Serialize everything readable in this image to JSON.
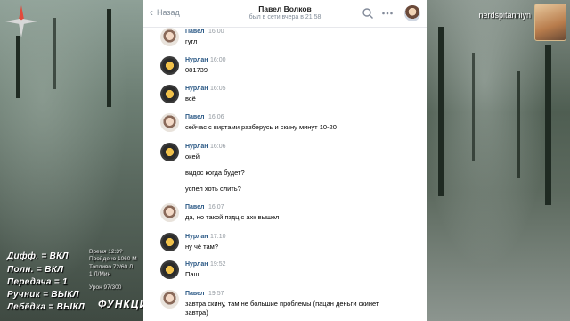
{
  "hud": {
    "lines": [
      "Дифф. = ВКЛ",
      "Полн. = ВКЛ",
      "Передача = 1",
      "Ручник = ВЫКЛ",
      "Лебёдка = ВЫКЛ"
    ],
    "small": [
      "Время 12:3?",
      "Пройдено 1060 М",
      "Топливо 72/60 Л",
      "1 Л/Мин",
      "Урон 97/300"
    ],
    "functions": "ФУНКЦИ",
    "streamer": "nerdspitanniyn"
  },
  "header": {
    "back_label": "Назад",
    "title": "Павел Волков",
    "status": "был в сети вчера в 21:58",
    "icons": [
      "search-icon",
      "more-icon"
    ]
  },
  "messages": [
    {
      "author": "Павел",
      "time": "16:00",
      "avatar": "pavel",
      "lines": [
        "гугл"
      ]
    },
    {
      "author": "Нурлан",
      "time": "16:00",
      "avatar": "nurlan",
      "lines": [
        "081739"
      ]
    },
    {
      "author": "Нурлан",
      "time": "16:05",
      "avatar": "nurlan",
      "lines": [
        "всё"
      ]
    },
    {
      "author": "Павел",
      "time": "16:06",
      "avatar": "pavel",
      "lines": [
        "сейчас с виртами разберусь и скину минут 10-20"
      ]
    },
    {
      "author": "Нурлан",
      "time": "16:06",
      "avatar": "nurlan",
      "lines": [
        "окей",
        "",
        "видос когда будет?",
        "",
        "успел хоть слить?"
      ]
    },
    {
      "author": "Павел",
      "time": "16:07",
      "avatar": "pavel",
      "lines": [
        "да, но такой пздц с ахк вышел"
      ]
    },
    {
      "author": "Нурлан",
      "time": "17:10",
      "avatar": "nurlan",
      "lines": [
        "ну чё там?"
      ]
    },
    {
      "author": "Нурлан",
      "time": "19:52",
      "avatar": "nurlan",
      "lines": [
        "Паш"
      ]
    },
    {
      "author": "Павел",
      "time": "19:57",
      "avatar": "pavel",
      "lines": [
        "завтра скину, там не большие проблемы (пацан деньги скинет",
        "завтра)"
      ]
    }
  ]
}
